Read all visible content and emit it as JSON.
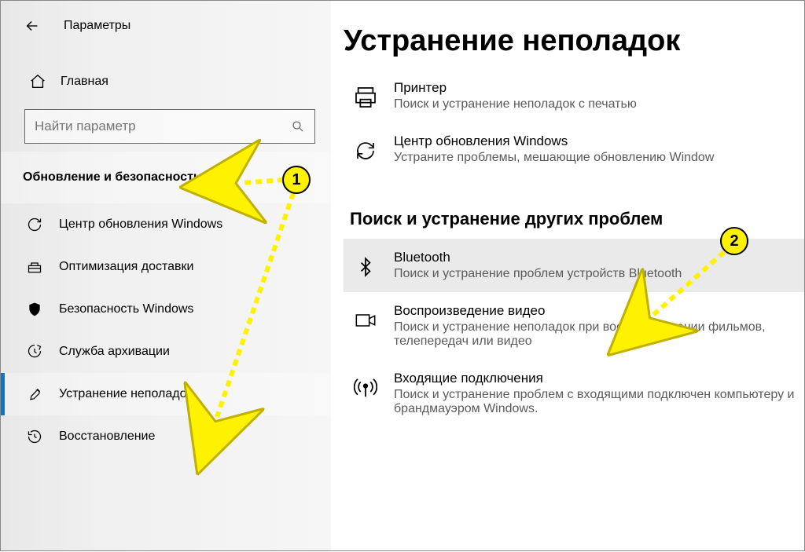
{
  "header": {
    "app_title": "Параметры"
  },
  "sidebar": {
    "home_label": "Главная",
    "search_placeholder": "Найти параметр",
    "section_title": "Обновление и безопасность",
    "items": [
      {
        "label": "Центр обновления Windows"
      },
      {
        "label": "Оптимизация доставки"
      },
      {
        "label": "Безопасность Windows"
      },
      {
        "label": "Служба архивации"
      },
      {
        "label": "Устранение неполадок"
      },
      {
        "label": "Восстановление"
      }
    ]
  },
  "main": {
    "title": "Устранение неполадок",
    "items_primary": [
      {
        "title": "Принтер",
        "desc": "Поиск и устранение неполадок с печатью"
      },
      {
        "title": "Центр обновления Windows",
        "desc": "Устраните проблемы, мешающие обновлению Window"
      }
    ],
    "subheading": "Поиск и устранение других проблем",
    "items_secondary": [
      {
        "title": "Bluetooth",
        "desc": "Поиск и устранение проблем устройств Bluetooth"
      },
      {
        "title": "Воспроизведение видео",
        "desc": "Поиск и устранение неполадок при воспроизведении фильмов, телепередач или видео"
      },
      {
        "title": "Входящие подключения",
        "desc": "Поиск и устранение проблем с входящими подключен компьютеру и брандмауэром Windows."
      }
    ]
  },
  "annotations": {
    "callout1": "1",
    "callout2": "2"
  }
}
